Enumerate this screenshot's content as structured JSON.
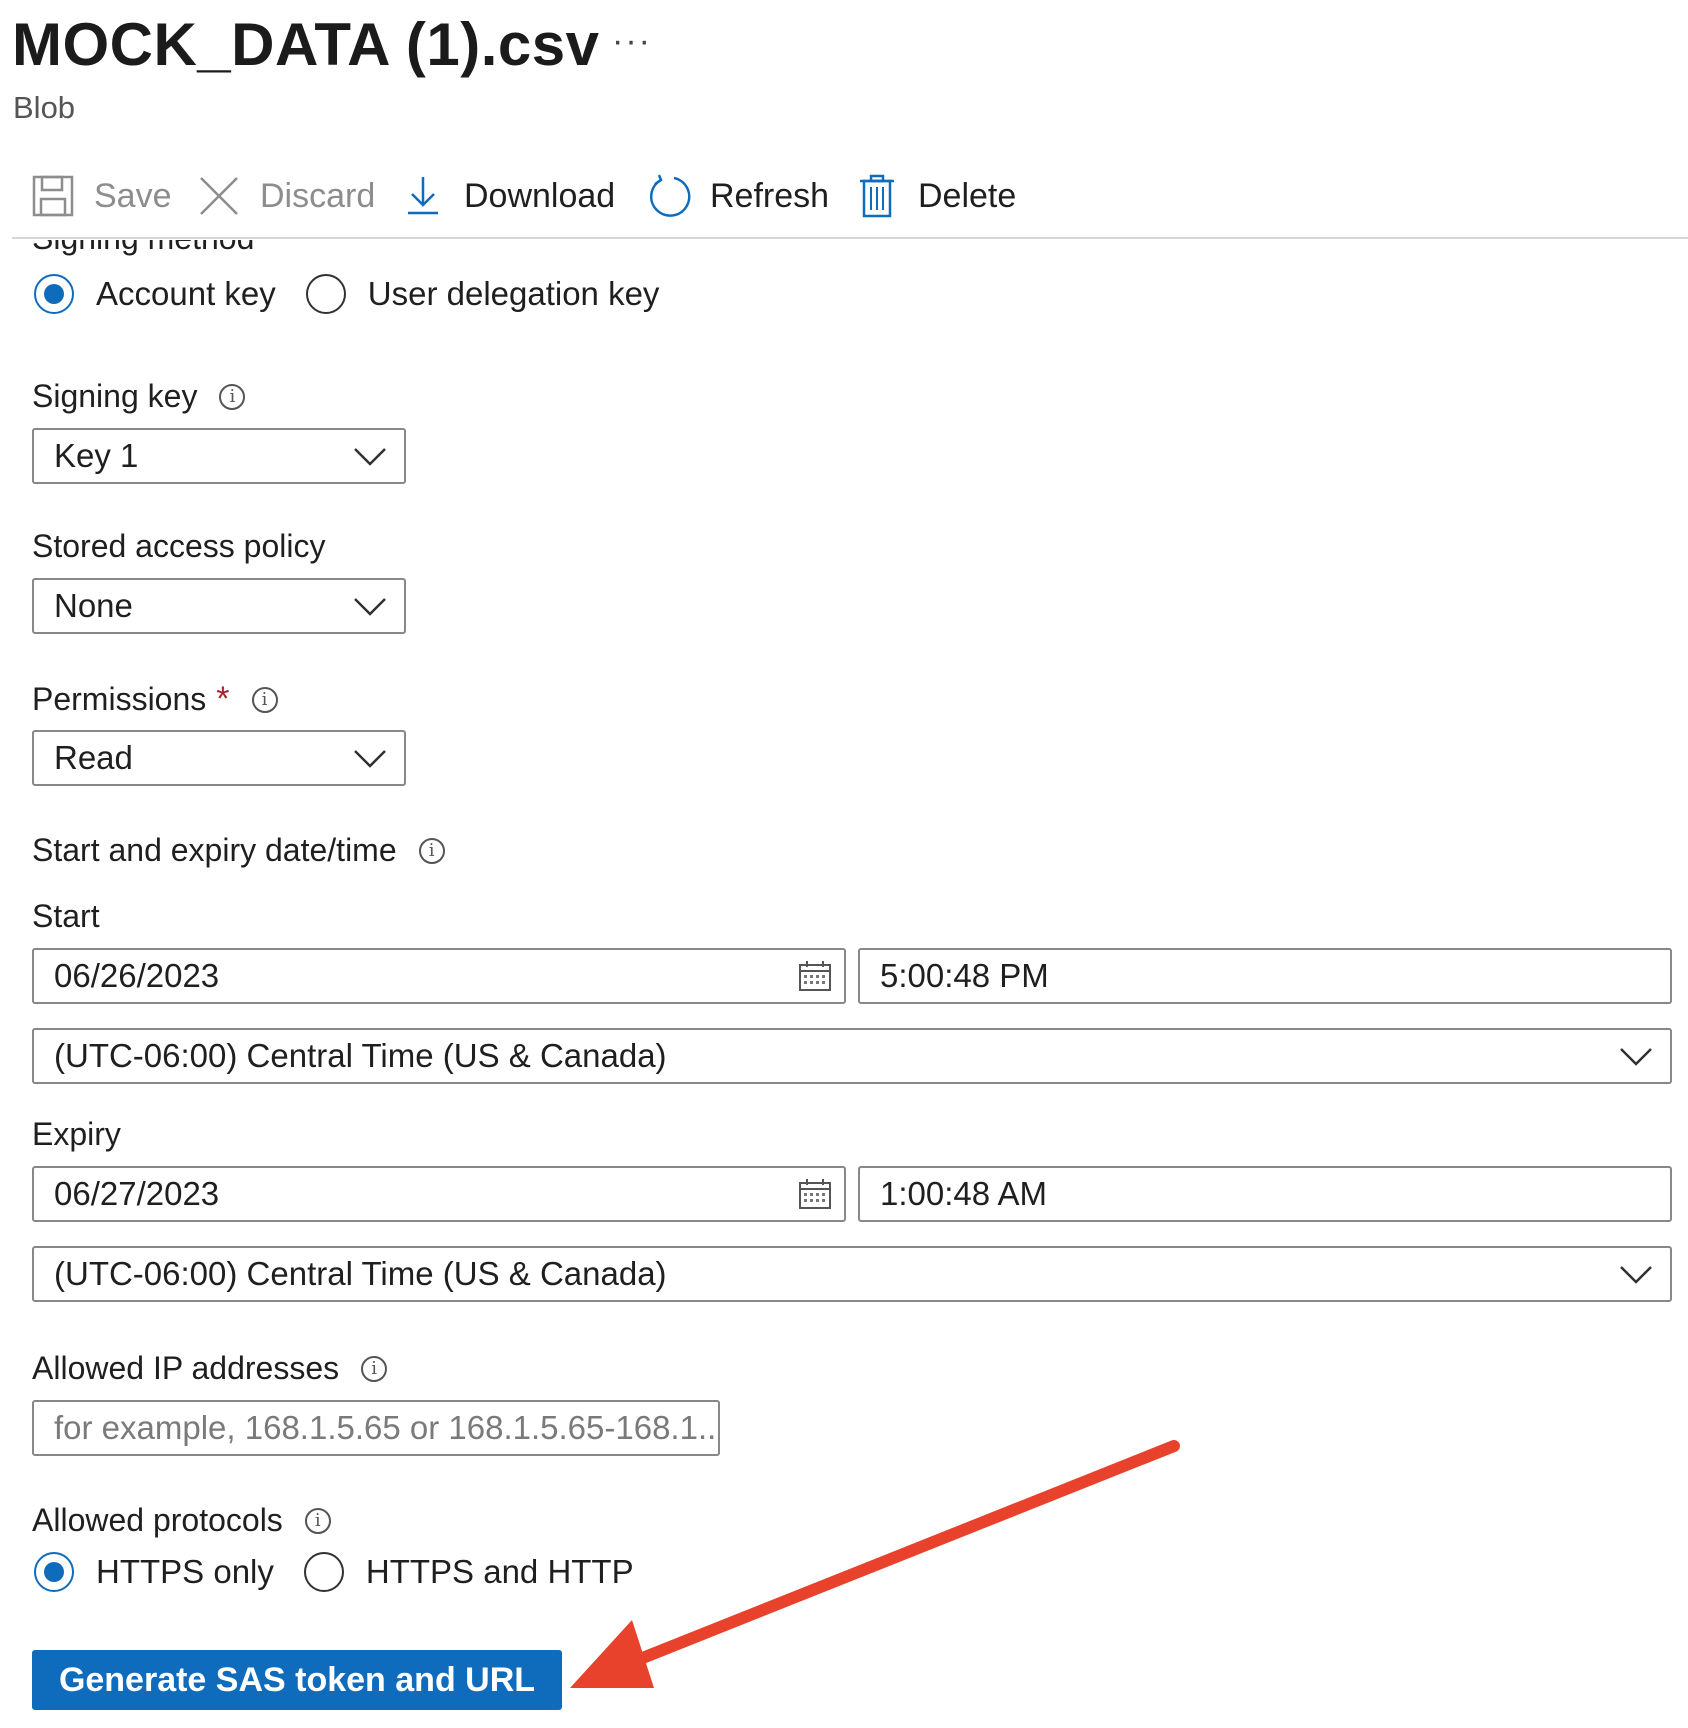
{
  "header": {
    "title": "MOCK_DATA (1).csv",
    "more": "···",
    "subtitle": "Blob"
  },
  "toolbar": {
    "save_label": "Save",
    "discard_label": "Discard",
    "download_label": "Download",
    "refresh_label": "Refresh",
    "delete_label": "Delete"
  },
  "form": {
    "signing_method_label": "Signing method",
    "signing_method_options": [
      "Account key",
      "User delegation key"
    ],
    "signing_method_selected": "Account key",
    "signing_key_label": "Signing key",
    "signing_key_value": "Key 1",
    "stored_policy_label": "Stored access policy",
    "stored_policy_value": "None",
    "permissions_label": "Permissions",
    "required_mark": "*",
    "permissions_value": "Read",
    "start_expiry_label": "Start and expiry date/time",
    "start_label": "Start",
    "start_date": "06/26/2023",
    "start_time": "5:00:48 PM",
    "start_timezone": "(UTC-06:00) Central Time (US & Canada)",
    "expiry_label": "Expiry",
    "expiry_date": "06/27/2023",
    "expiry_time": "1:00:48 AM",
    "expiry_timezone": "(UTC-06:00) Central Time (US & Canada)",
    "allowed_ip_label": "Allowed IP addresses",
    "allowed_ip_placeholder": "for example, 168.1.5.65 or 168.1.5.65-168.1....",
    "allowed_protocols_label": "Allowed protocols",
    "protocol_options": [
      "HTTPS only",
      "HTTPS and HTTP"
    ],
    "protocol_selected": "HTTPS only",
    "generate_button": "Generate SAS token and URL"
  },
  "colors": {
    "accent": "#0f6cbd",
    "annotation_arrow": "#e8412c",
    "required": "#a4262c"
  },
  "icons": [
    "save-icon",
    "discard-icon",
    "download-icon",
    "refresh-icon",
    "delete-icon",
    "info-icon",
    "chevron-down-icon",
    "calendar-icon"
  ]
}
